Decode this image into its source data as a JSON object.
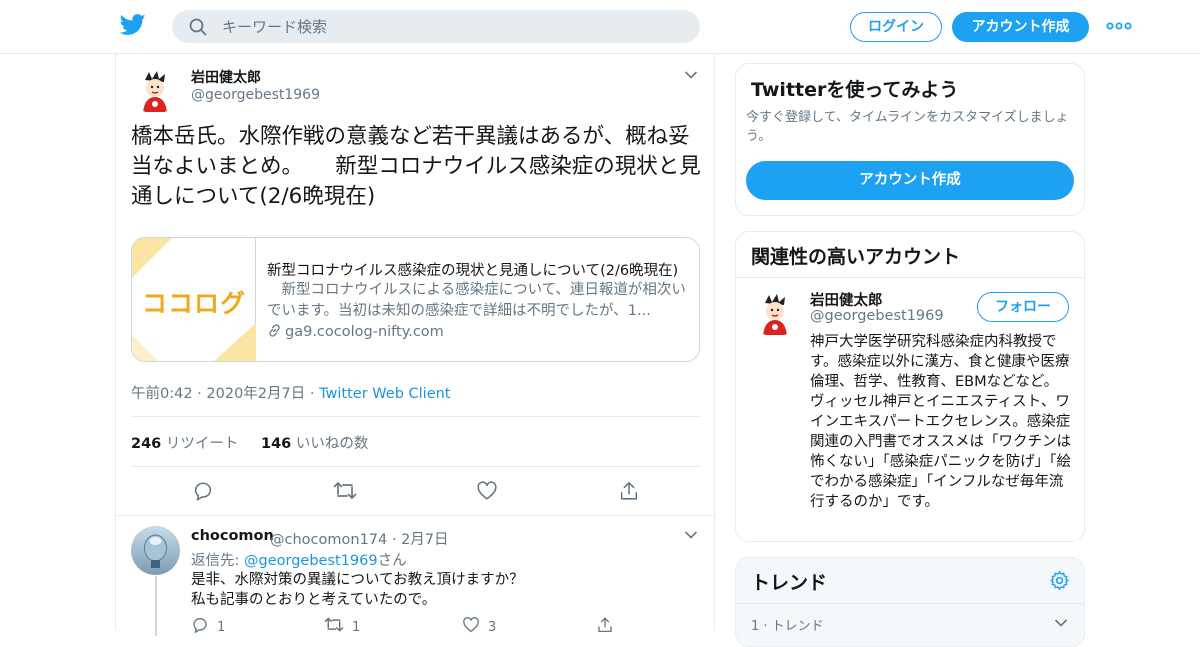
{
  "header": {
    "search_placeholder": "キーワード検索",
    "login": "ログイン",
    "signup": "アカウント作成"
  },
  "tweet": {
    "name": "岩田健太郎",
    "handle": "@georgebest1969",
    "text": "橋本岳氏。水際作戦の意義など若干異議はあるが、概ね妥当なよいまとめ。　　新型コロナウイルス感染症の現状と見通しについて(2/6晩現在)",
    "card": {
      "logo": "ココログ",
      "title": "新型コロナウイルス感染症の現状と見通しについて(2/6晩現在)",
      "description": "　新型コロナウイルスによる感染症について、連日報道が相次いでいます。当初は未知の感染症で詳細は不明でしたが、1...",
      "domain": "ga9.cocolog-nifty.com"
    },
    "time": "午前0:42 · 2020年2月7日",
    "sep": " · ",
    "client": "Twitter Web Client",
    "retweets": "246",
    "retweets_label": "リツイート",
    "likes": "146",
    "likes_label": "いいねの数"
  },
  "reply": {
    "name": "chocomon",
    "handle": "@chocomon174 · 2月7日",
    "reply_prefix": "返信先: ",
    "reply_target": "@georgebest1969",
    "reply_suffix": "さん",
    "line1": "是非、水際対策の異議についてお教え頂けますか？",
    "line2": "私も記事のとおりと考えていたので。",
    "replies": "1",
    "retweets": "1",
    "likes": "3"
  },
  "sidebar": {
    "try_title": "Twitterを使ってみよう",
    "try_sub": "今すぐ登録して、タイムラインをカスタマイズしましょう。",
    "try_button": "アカウント作成",
    "related_title": "関連性の高いアカウント",
    "related_name": "岩田健太郎",
    "related_handle": "@georgebest1969",
    "follow_label": "フォロー",
    "bio": "神戸大学医学研究科感染症内科教授です。感染症以外に漢方、食と健康や医療倫理、哲学、性教育、EBMなどなど。ヴィッセル神戸とイニエスティスト、ワインエキスパートエクセレンス。感染症関連の入門書でオススメは「ワクチンは怖くない」「感染症パニックを防げ」「絵でわかる感染症」「インフルなぜ毎年流行するのか」です。",
    "trends_title": "トレンド",
    "trend_1": "1 · トレンド"
  },
  "colors": {
    "accent": "#1da1f2",
    "link": "#1b95e0",
    "muted": "#657786",
    "logo_orange": "#f0a81e"
  }
}
